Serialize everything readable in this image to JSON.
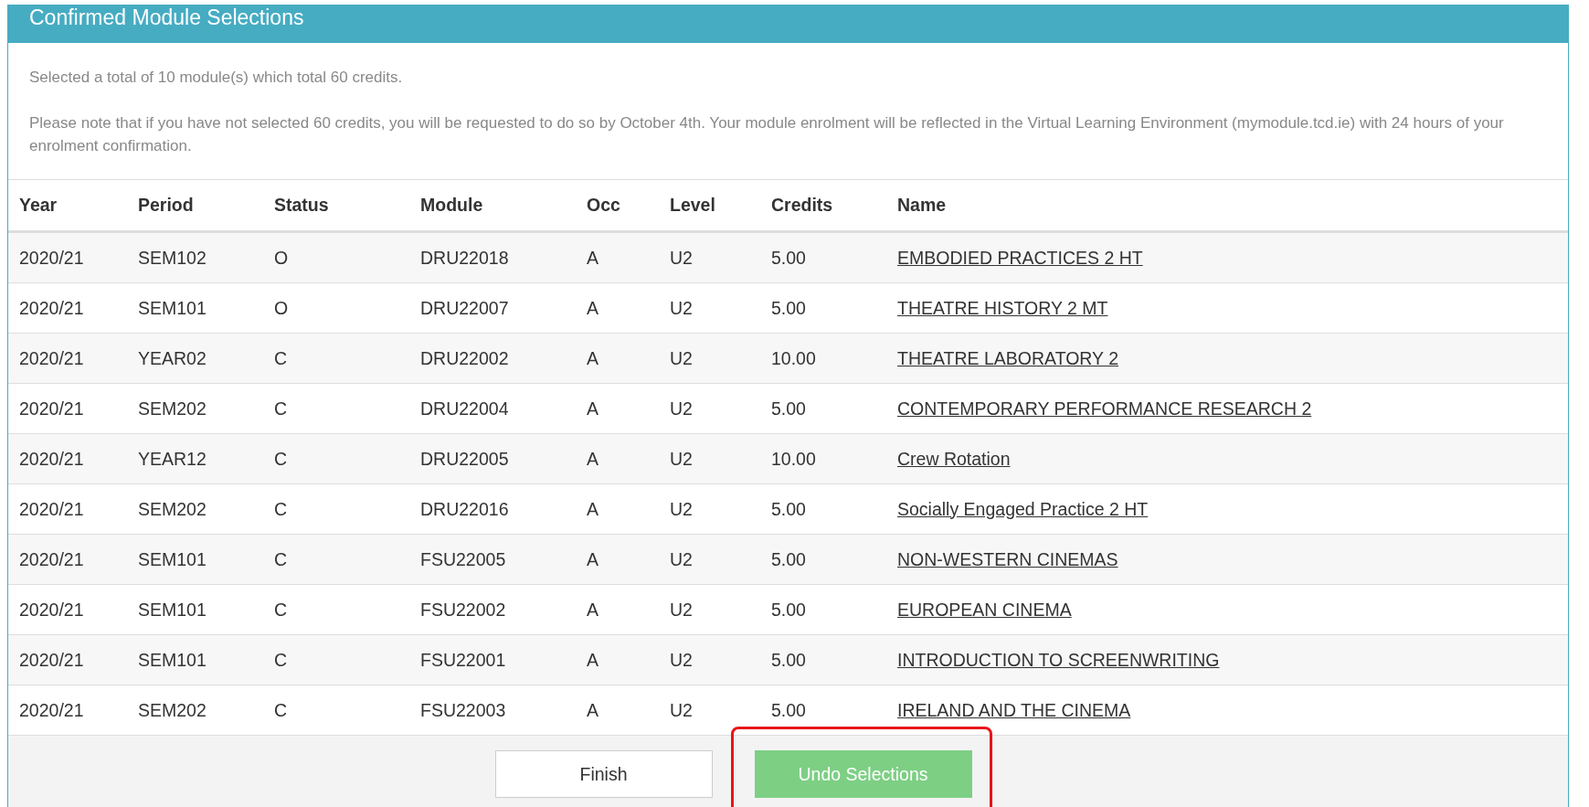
{
  "panel": {
    "title": "Confirmed Module Selections",
    "summary": "Selected a total of 10 module(s) which total 60 credits.",
    "note": "Please note that if you have not selected 60 credits, you will be requested to do so by October 4th. Your module enrolment will be reflected in the Virtual Learning Environment (mymodule.tcd.ie) with 24 hours of your enrolment confirmation."
  },
  "table": {
    "columns": [
      "Year",
      "Period",
      "Status",
      "Module",
      "Occ",
      "Level",
      "Credits",
      "Name"
    ],
    "rows": [
      {
        "year": "2020/21",
        "period": "SEM102",
        "status": "O",
        "module": "DRU22018",
        "occ": "A",
        "level": "U2",
        "credits": "5.00",
        "name": "EMBODIED PRACTICES 2 HT"
      },
      {
        "year": "2020/21",
        "period": "SEM101",
        "status": "O",
        "module": "DRU22007",
        "occ": "A",
        "level": "U2",
        "credits": "5.00",
        "name": "THEATRE HISTORY 2 MT"
      },
      {
        "year": "2020/21",
        "period": "YEAR02",
        "status": "C",
        "module": "DRU22002",
        "occ": "A",
        "level": "U2",
        "credits": "10.00",
        "name": "THEATRE LABORATORY 2"
      },
      {
        "year": "2020/21",
        "period": "SEM202",
        "status": "C",
        "module": "DRU22004",
        "occ": "A",
        "level": "U2",
        "credits": "5.00",
        "name": "CONTEMPORARY PERFORMANCE RESEARCH 2"
      },
      {
        "year": "2020/21",
        "period": "YEAR12",
        "status": "C",
        "module": "DRU22005",
        "occ": "A",
        "level": "U2",
        "credits": "10.00",
        "name": "Crew Rotation"
      },
      {
        "year": "2020/21",
        "period": "SEM202",
        "status": "C",
        "module": "DRU22016",
        "occ": "A",
        "level": "U2",
        "credits": "5.00",
        "name": "Socially Engaged Practice 2 HT"
      },
      {
        "year": "2020/21",
        "period": "SEM101",
        "status": "C",
        "module": "FSU22005",
        "occ": "A",
        "level": "U2",
        "credits": "5.00",
        "name": "NON-WESTERN CINEMAS"
      },
      {
        "year": "2020/21",
        "period": "SEM101",
        "status": "C",
        "module": "FSU22002",
        "occ": "A",
        "level": "U2",
        "credits": "5.00",
        "name": "EUROPEAN CINEMA"
      },
      {
        "year": "2020/21",
        "period": "SEM101",
        "status": "C",
        "module": "FSU22001",
        "occ": "A",
        "level": "U2",
        "credits": "5.00",
        "name": "INTRODUCTION TO SCREENWRITING"
      },
      {
        "year": "2020/21",
        "period": "SEM202",
        "status": "C",
        "module": "FSU22003",
        "occ": "A",
        "level": "U2",
        "credits": "5.00",
        "name": "IRELAND AND THE CINEMA"
      }
    ]
  },
  "buttons": [
    {
      "label": "Finish",
      "kind": "plain",
      "highlighted": false
    },
    {
      "label": "Undo Selections",
      "kind": "success",
      "highlighted": true
    }
  ]
}
